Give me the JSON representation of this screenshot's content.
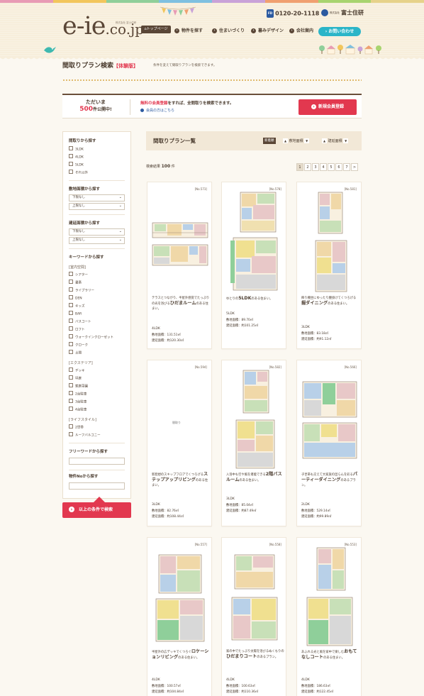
{
  "header": {
    "stripe_colors": [
      "#e89bb5",
      "#f2c65c",
      "#8fcf9a",
      "#7fc0e0",
      "#c9a2d8",
      "#f0a070",
      "#a8d46f",
      "#e6d28a"
    ],
    "logo_main": "e-ie",
    "logo_tld": ".co.jp",
    "logo_sub": "株式会社 富士住研",
    "top_page": "トップページ",
    "phone_badge": "FD",
    "phone": "0120-20-1118",
    "company_prefix": "株式会社",
    "company": "富士住研",
    "nav": [
      "物件を探す",
      "住まいづくり",
      "暮みデザイン",
      "会社案内"
    ],
    "contact": "お問い合わせ"
  },
  "page": {
    "title": "間取りプラン検索",
    "beta": "【体験版】",
    "description": "条件を変えて間取りプランを検索できます。"
  },
  "promo": {
    "line1": "ただいま",
    "count": "500",
    "count_suffix": "件公開中!",
    "msg_highlight": "無料の会員登録",
    "msg_rest": "をすれば、全間取りを検索できます。",
    "login": "会員の方はこちら",
    "register": "新規会員登録"
  },
  "sidebar": {
    "madori_h": "間取りから探す",
    "madori": [
      "3LDK",
      "4LDK",
      "5LDK",
      "それ以外"
    ],
    "shiki_h": "敷地面積から探す",
    "shiki_min": "下限なし",
    "shiki_max": "上限なし",
    "kenchiku_h": "建延面積から探す",
    "kenchiku_min": "下限なし",
    "kenchiku_max": "上限なし",
    "keyword_h": "キーワードから探す",
    "indoor_h": "[室内空間]",
    "indoor": [
      "シアター",
      "書斎",
      "ライブラリー",
      "DEN",
      "キッズ",
      "BAR",
      "バスコート",
      "ロフト",
      "ウォークインクローゼット",
      "クローク",
      "土間"
    ],
    "exterior_h": "[エクステリア]",
    "exterior": [
      "デッキ",
      "坪庭",
      "家庭菜園",
      "2台駐車",
      "3台駐車",
      "4台駐車"
    ],
    "lifestyle_h": "[ライフスタイル]",
    "lifestyle": [
      "2世帯",
      "ルーフバルコニー"
    ],
    "freeword_h": "フリーワードから探す",
    "no_h": "物件Noから探す",
    "search_btn": "以上の条件で検索"
  },
  "main": {
    "title": "間取りプラン一覧",
    "sort_new": "新着順",
    "sort_shiki": "敷地面積",
    "sort_kenchiku": "建延面積",
    "result_label": "検索結果",
    "result_count": "100",
    "result_unit": "件",
    "pages": [
      "1",
      "2",
      "3",
      "4",
      "5",
      "6",
      "7",
      ">"
    ]
  },
  "cards": [
    {
      "no": "[No.573]",
      "pre": "テラスとつながり、半屋外感覚でたっぷりの光を浴びる",
      "bold": "ひだまルーム",
      "post": "のある住まい。",
      "layout": "4LDK",
      "site": "敷地面積：131.51㎡",
      "floor": "建延面積：約120.30㎡"
    },
    {
      "no": "[No.578]",
      "pre": "ゆとりの",
      "bold": "5LDK",
      "post": "のある住まい。",
      "layout": "5LDK",
      "site": "敷地面積：89.70㎡",
      "floor": "建延面積：約101.25㎡"
    },
    {
      "no": "[No.581]",
      "pre": "飾り棚坐にゆったり腰掛けてくつろげる",
      "bold": "掘ダイニング",
      "post": "のある住まい。",
      "layout": "3LDK",
      "site": "敷地面積：83.18㎡",
      "floor": "建延面積：約91.12㎡"
    },
    {
      "no": "[No.594]",
      "img_alt": "間取り",
      "pre": "新発想のスキップフロアでくつろげる",
      "bold": "ステップアップリビング",
      "post": "のある住まい。",
      "layout": "3LDK",
      "site": "敷地面積：82.76㎡",
      "floor": "建延面積：約108.44㎡"
    },
    {
      "no": "[No.582]",
      "pre": "入浴中も空や風を堪能できる",
      "bold": "2階バスルーム",
      "post": "のある住まい。",
      "layout": "3LDK",
      "site": "敷地面積：85.04㎡",
      "floor": "建延面積：約87.49㎡"
    },
    {
      "no": "[No.566]",
      "pre": "子世帯も交えて大家族の団らんを彩る",
      "bold": "パーティーダイニング",
      "post": "のあるプラン。",
      "layout": "2LDK",
      "site": "敷地面積：529.14㎡",
      "floor": "建延面積：約99.89㎡"
    },
    {
      "no": "[No.557]",
      "pre": "半屋外の広デッキでくつろぐ",
      "bold": "ロケーションリビング",
      "post": "のある住まい。",
      "layout": "4LDK",
      "site": "敷地面積：100.57㎡",
      "floor": "建延面積：約104.84㎡"
    },
    {
      "no": "[No.558]",
      "pre": "家の中でたっぷり太陽を浴びるぬくもりの",
      "bold": "ひだまりコート",
      "post": "のあるプラン。",
      "layout": "4LDK",
      "site": "敷地面積：100.63㎡",
      "floor": "建延面積：約110.36㎡"
    },
    {
      "no": "[No.553]",
      "pre": "あふれる光と風を家中で楽しむ",
      "bold": "おもてなしコート",
      "post": "のある住まい。",
      "layout": "4LDK",
      "site": "敷地面積：186.63㎡",
      "floor": "建延面積：約122.45㎡"
    }
  ]
}
